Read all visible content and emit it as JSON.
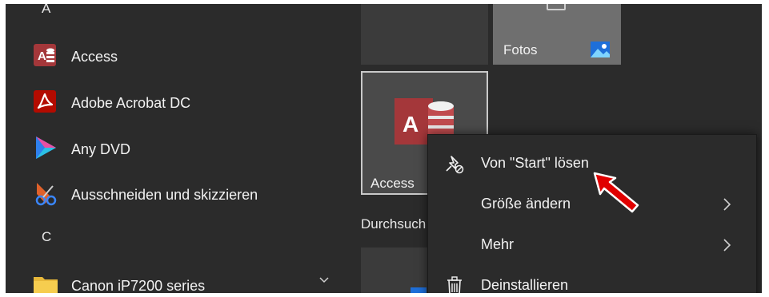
{
  "app_list": {
    "section_a": "A",
    "section_c": "C",
    "apps": [
      {
        "label": "Access",
        "icon": "access-icon"
      },
      {
        "label": "Adobe Acrobat DC",
        "icon": "acrobat-icon"
      },
      {
        "label": "Any DVD",
        "icon": "anydvd-icon"
      },
      {
        "label": "Ausschneiden und skizzieren",
        "icon": "snip-sketch-icon"
      },
      {
        "label": "Canon iP7200 series",
        "icon": "folder-icon"
      }
    ]
  },
  "tiles": {
    "fotos": {
      "label": "Fotos",
      "icon": "photos-icon"
    },
    "access": {
      "label": "Access",
      "icon": "access-icon"
    },
    "group_header": "Durchsuch"
  },
  "context_menu": {
    "items": [
      {
        "label": "Von \"Start\" lösen",
        "icon": "unpin-icon"
      },
      {
        "label": "Größe ändern",
        "icon": "chevron-right-icon"
      },
      {
        "label": "Mehr",
        "icon": "chevron-right-icon"
      },
      {
        "label": "Deinstallieren",
        "icon": "trash-icon"
      }
    ]
  },
  "colors": {
    "background": "#2b2b2b",
    "tile": "#3b3b3b",
    "tile_light": "#6f6f6f",
    "access_red": "#a4373a",
    "annotation_red": "#e00000"
  }
}
